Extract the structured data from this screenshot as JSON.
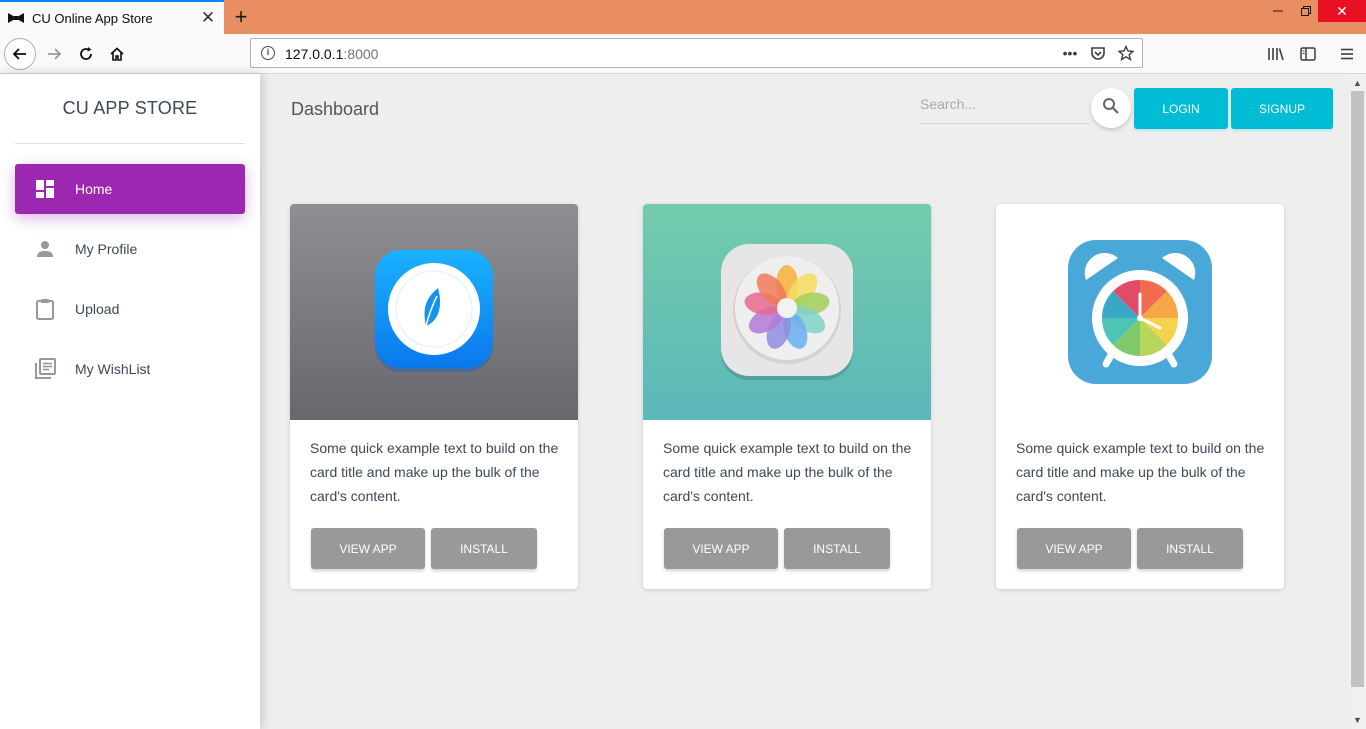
{
  "browser": {
    "tab_title": "CU Online App Store",
    "url_host": "127.0.0.1",
    "url_port": ":8000",
    "accent_color": "#0a84ff",
    "titlebar_color": "#e98e63"
  },
  "sidebar": {
    "brand": "CU APP STORE",
    "items": [
      {
        "label": "Home",
        "icon": "dashboard-icon",
        "active": true
      },
      {
        "label": "My Profile",
        "icon": "person-icon",
        "active": false
      },
      {
        "label": "Upload",
        "icon": "clipboard-icon",
        "active": false
      },
      {
        "label": "My WishList",
        "icon": "library-books-icon",
        "active": false
      }
    ],
    "active_color": "#9c27b0"
  },
  "header": {
    "title": "Dashboard",
    "search_placeholder": "Search...",
    "login_label": "LOGIN",
    "signup_label": "SIGNUP",
    "button_color": "#00bcd4"
  },
  "cards": [
    {
      "icon": "leaf-app-icon",
      "image_bg": "gray-gradient",
      "text": "Some quick example text to build on the card title and make up the bulk of the card's content.",
      "view_label": "VIEW APP",
      "install_label": "INSTALL"
    },
    {
      "icon": "photos-flower-icon",
      "image_bg": "teal-gradient",
      "text": "Some quick example text to build on the card title and make up the bulk of the card's content.",
      "view_label": "VIEW APP",
      "install_label": "INSTALL"
    },
    {
      "icon": "alarm-clock-icon",
      "image_bg": "white",
      "text": "Some quick example text to build on the card title and make up the bulk of the card's content.",
      "view_label": "VIEW APP",
      "install_label": "INSTALL"
    }
  ]
}
